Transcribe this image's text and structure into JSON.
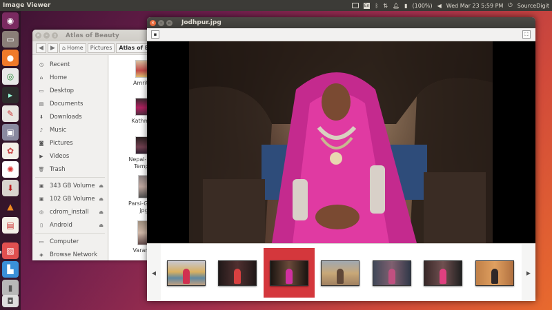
{
  "topbar": {
    "app_title": "Image Viewer",
    "battery": "(100%)",
    "datetime": "Wed Mar 23  5:59 PM",
    "user": "SourceDigit",
    "keyboard": "En"
  },
  "launcher": {
    "items": [
      "ubuntu-dash",
      "files",
      "firefox",
      "chrome",
      "terminal",
      "text-editor",
      "system-settings",
      "color-picker",
      "pinwheel-app",
      "transmission",
      "vlc",
      "software-center",
      "image-viewer",
      "document-app",
      "usb-drive",
      "trash"
    ]
  },
  "file_manager": {
    "title": "Atlas of Beauty",
    "breadcrumbs": [
      "Home",
      "Pictures",
      "Atlas of Be"
    ],
    "sidebar": [
      {
        "icon": "clock-icon",
        "label": "Recent"
      },
      {
        "icon": "home-icon",
        "label": "Home"
      },
      {
        "icon": "desktop-icon",
        "label": "Desktop"
      },
      {
        "icon": "document-icon",
        "label": "Documents"
      },
      {
        "icon": "download-icon",
        "label": "Downloads"
      },
      {
        "icon": "music-icon",
        "label": "Music"
      },
      {
        "icon": "camera-icon",
        "label": "Pictures"
      },
      {
        "icon": "video-icon",
        "label": "Videos"
      },
      {
        "icon": "trash-icon",
        "label": "Trash"
      },
      {
        "icon": "drive-icon",
        "label": "343 GB Volume",
        "eject": true
      },
      {
        "icon": "drive-icon",
        "label": "102 GB Volume",
        "eject": true
      },
      {
        "icon": "disc-icon",
        "label": "cdrom_install",
        "eject": true
      },
      {
        "icon": "phone-icon",
        "label": "Android",
        "eject": true
      },
      {
        "icon": "computer-icon",
        "label": "Computer"
      },
      {
        "icon": "network-icon",
        "label": "Browse Network"
      }
    ],
    "files": [
      {
        "line1": "Amritsa",
        "line2": ""
      },
      {
        "line1": "Kathman",
        "line2": ""
      },
      {
        "line1": "Nepal-Kath",
        "line2": "Temple"
      },
      {
        "line1": "Parsi-Girl-N",
        "line2": "jpg"
      },
      {
        "line1": "Varanas",
        "line2": ""
      }
    ]
  },
  "viewer": {
    "title": "Jodhpur.jpg",
    "thumbnails": 7,
    "selected_index": 2
  },
  "colors": {
    "accent": "#d4373c",
    "close_button": "#e96b3c",
    "panel": "#3c3b37"
  }
}
